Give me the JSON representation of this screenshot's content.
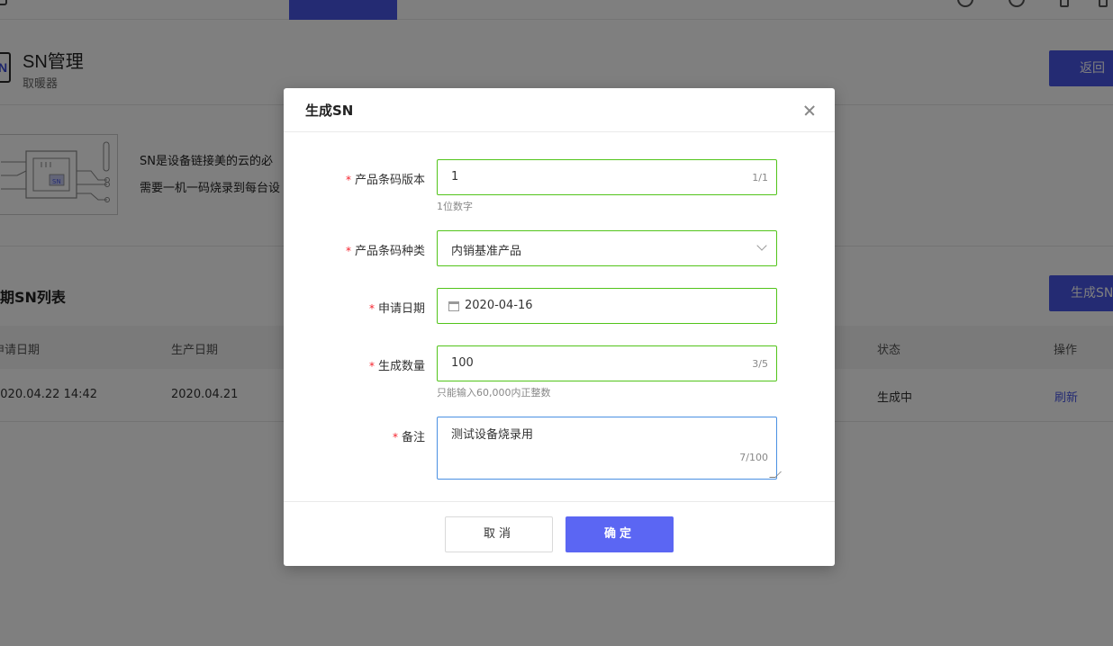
{
  "page": {
    "title": "SN管理",
    "subtitle": "取暖器",
    "back_label": "返回",
    "intro_line1": "SN是设备链接美的云的必",
    "intro_line2": "需要一机一码烧录到每台设",
    "list_title": "期SN列表",
    "generate_label": "生成SN",
    "table": {
      "headers": [
        "申请日期",
        "生产日期",
        "状态",
        "操作"
      ],
      "row": {
        "apply_date": "2020.04.22 14:42",
        "prod_date": "2020.04.21",
        "status": "生成中",
        "action": "刷新"
      }
    }
  },
  "modal": {
    "title": "生成SN",
    "fields": {
      "version": {
        "label": "产品条码版本",
        "value": "1",
        "count": "1/1",
        "hint": "1位数字"
      },
      "category": {
        "label": "产品条码种类",
        "value": "内销基准产品"
      },
      "date": {
        "label": "申请日期",
        "value": "2020-04-16"
      },
      "quantity": {
        "label": "生成数量",
        "value": "100",
        "count": "3/5",
        "hint": "只能输入60,000内正整数"
      },
      "note": {
        "label": "备注",
        "value": "测试设备烧录用",
        "count": "7/100"
      }
    },
    "required_mark": "*",
    "cancel_label": "取消",
    "ok_label": "确定"
  },
  "icons": {
    "chip_label": "SN",
    "logo_text": "N"
  },
  "colors": {
    "primary": "#4957e6",
    "valid_border": "#52c41a",
    "focus_border": "#4a90e2",
    "required": "#f5222d"
  }
}
